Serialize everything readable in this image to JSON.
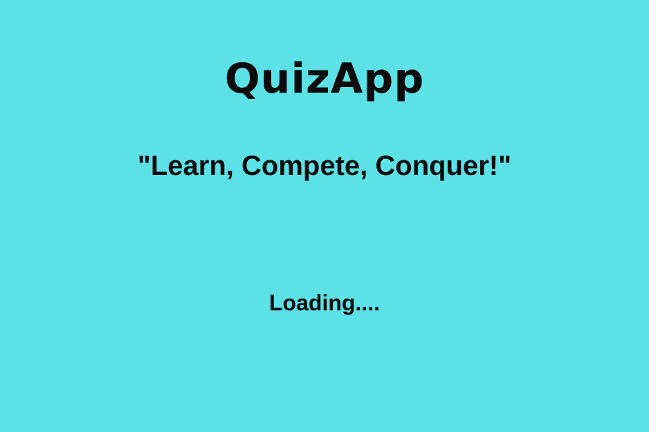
{
  "app": {
    "title": "QuizApp",
    "tagline": "\"Learn, Compete, Conquer!\"",
    "loading_text": "Loading....",
    "background_color": "#5ce1e6",
    "text_color": "#0b0b0b"
  }
}
